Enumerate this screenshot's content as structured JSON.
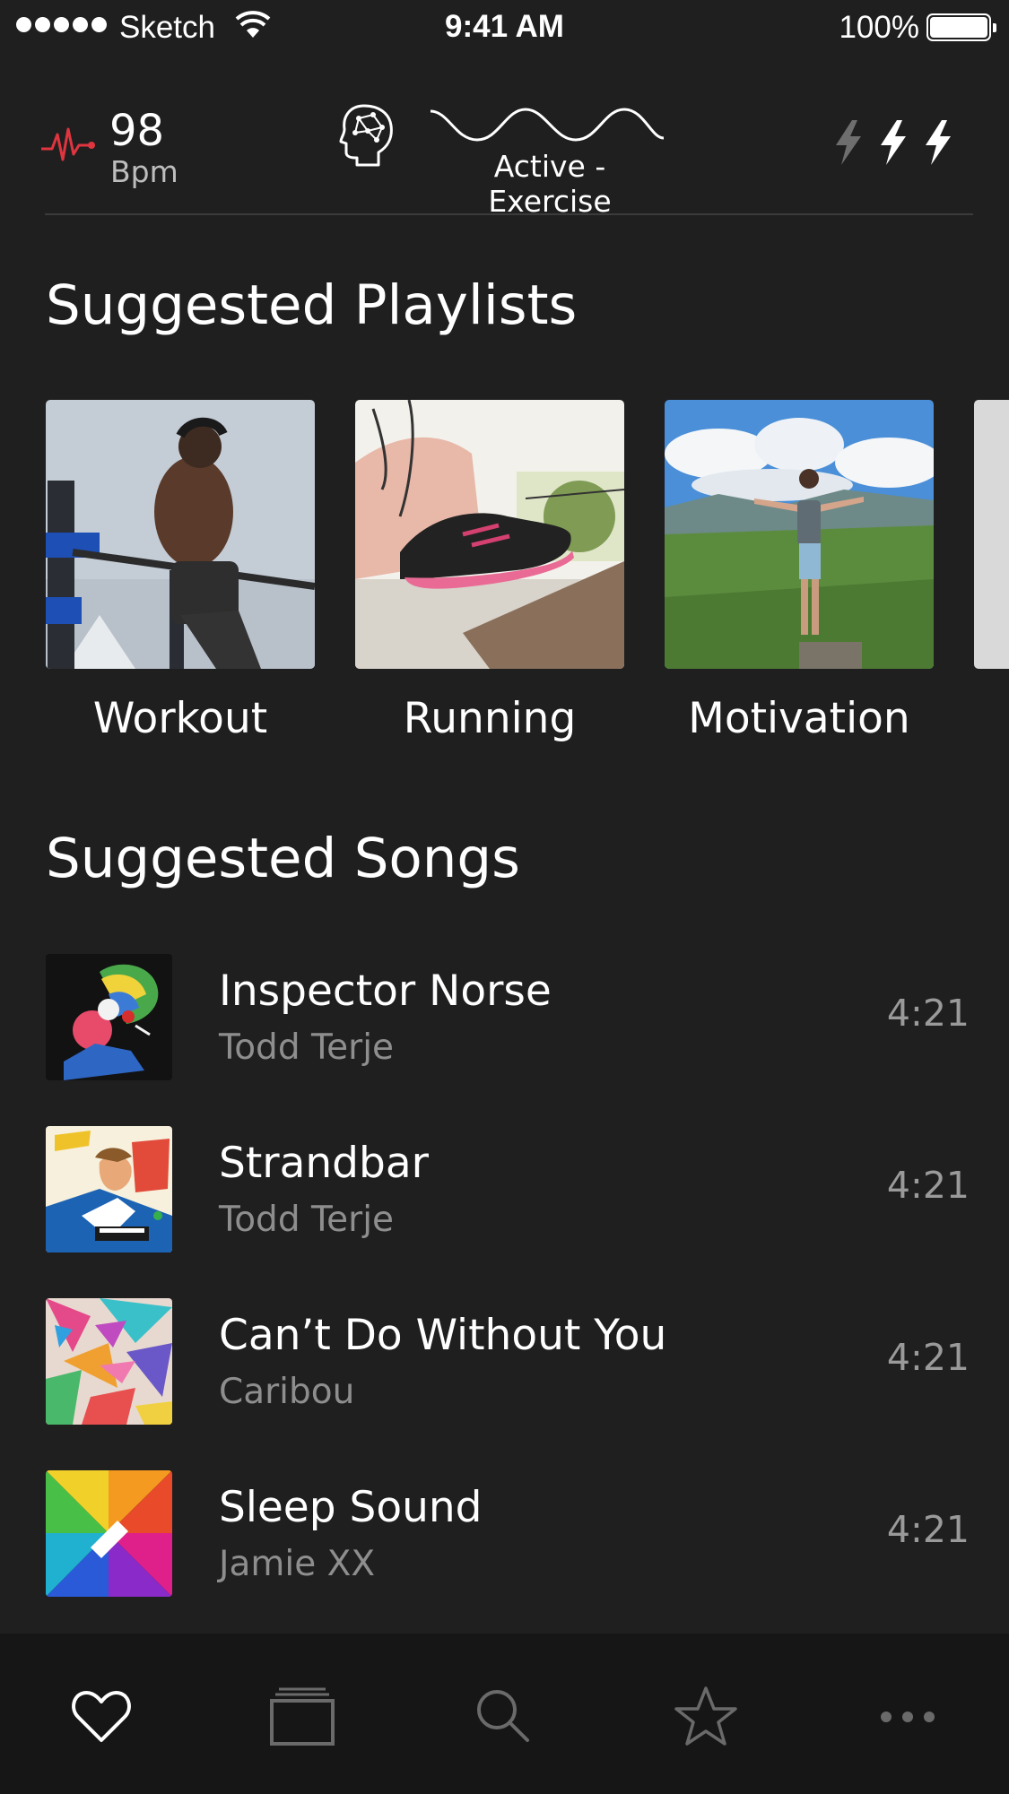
{
  "status_bar": {
    "carrier": "Sketch",
    "time": "9:41 AM",
    "battery": "100%"
  },
  "metrics": {
    "bpm_value": "98",
    "bpm_unit": "Bpm",
    "mode": "Active - Exercise",
    "energy_level": 2,
    "energy_max": 3,
    "colors": {
      "pulse": "#e0353f",
      "energy_on": "#ffffff",
      "energy_off": "#6e6e6e"
    }
  },
  "sections": {
    "playlists_title": "Suggested Playlists",
    "songs_title": "Suggested Songs"
  },
  "playlists": [
    {
      "label": "Workout",
      "image": "athlete-on-bars"
    },
    {
      "label": "Running",
      "image": "running-shoe"
    },
    {
      "label": "Motivation",
      "image": "man-on-mountain"
    }
  ],
  "songs": [
    {
      "title": "Inspector Norse",
      "artist": "Todd Terje",
      "duration": "4:21",
      "cover": "todd-terje-cover-1"
    },
    {
      "title": "Strandbar",
      "artist": "Todd Terje",
      "duration": "4:21",
      "cover": "todd-terje-album-time"
    },
    {
      "title": "Can’t Do Without You",
      "artist": "Caribou",
      "duration": "4:21",
      "cover": "caribou-colorful"
    },
    {
      "title": "Sleep Sound",
      "artist": "Jamie XX",
      "duration": "4:21",
      "cover": "jamie-xx-spectrum"
    }
  ],
  "tabbar": {
    "tabs": [
      {
        "name": "favorites",
        "icon": "heart-icon",
        "active": true
      },
      {
        "name": "library",
        "icon": "stack-icon",
        "active": false
      },
      {
        "name": "search",
        "icon": "search-icon",
        "active": false
      },
      {
        "name": "starred",
        "icon": "star-icon",
        "active": false
      },
      {
        "name": "more",
        "icon": "more-icon",
        "active": false
      }
    ]
  }
}
